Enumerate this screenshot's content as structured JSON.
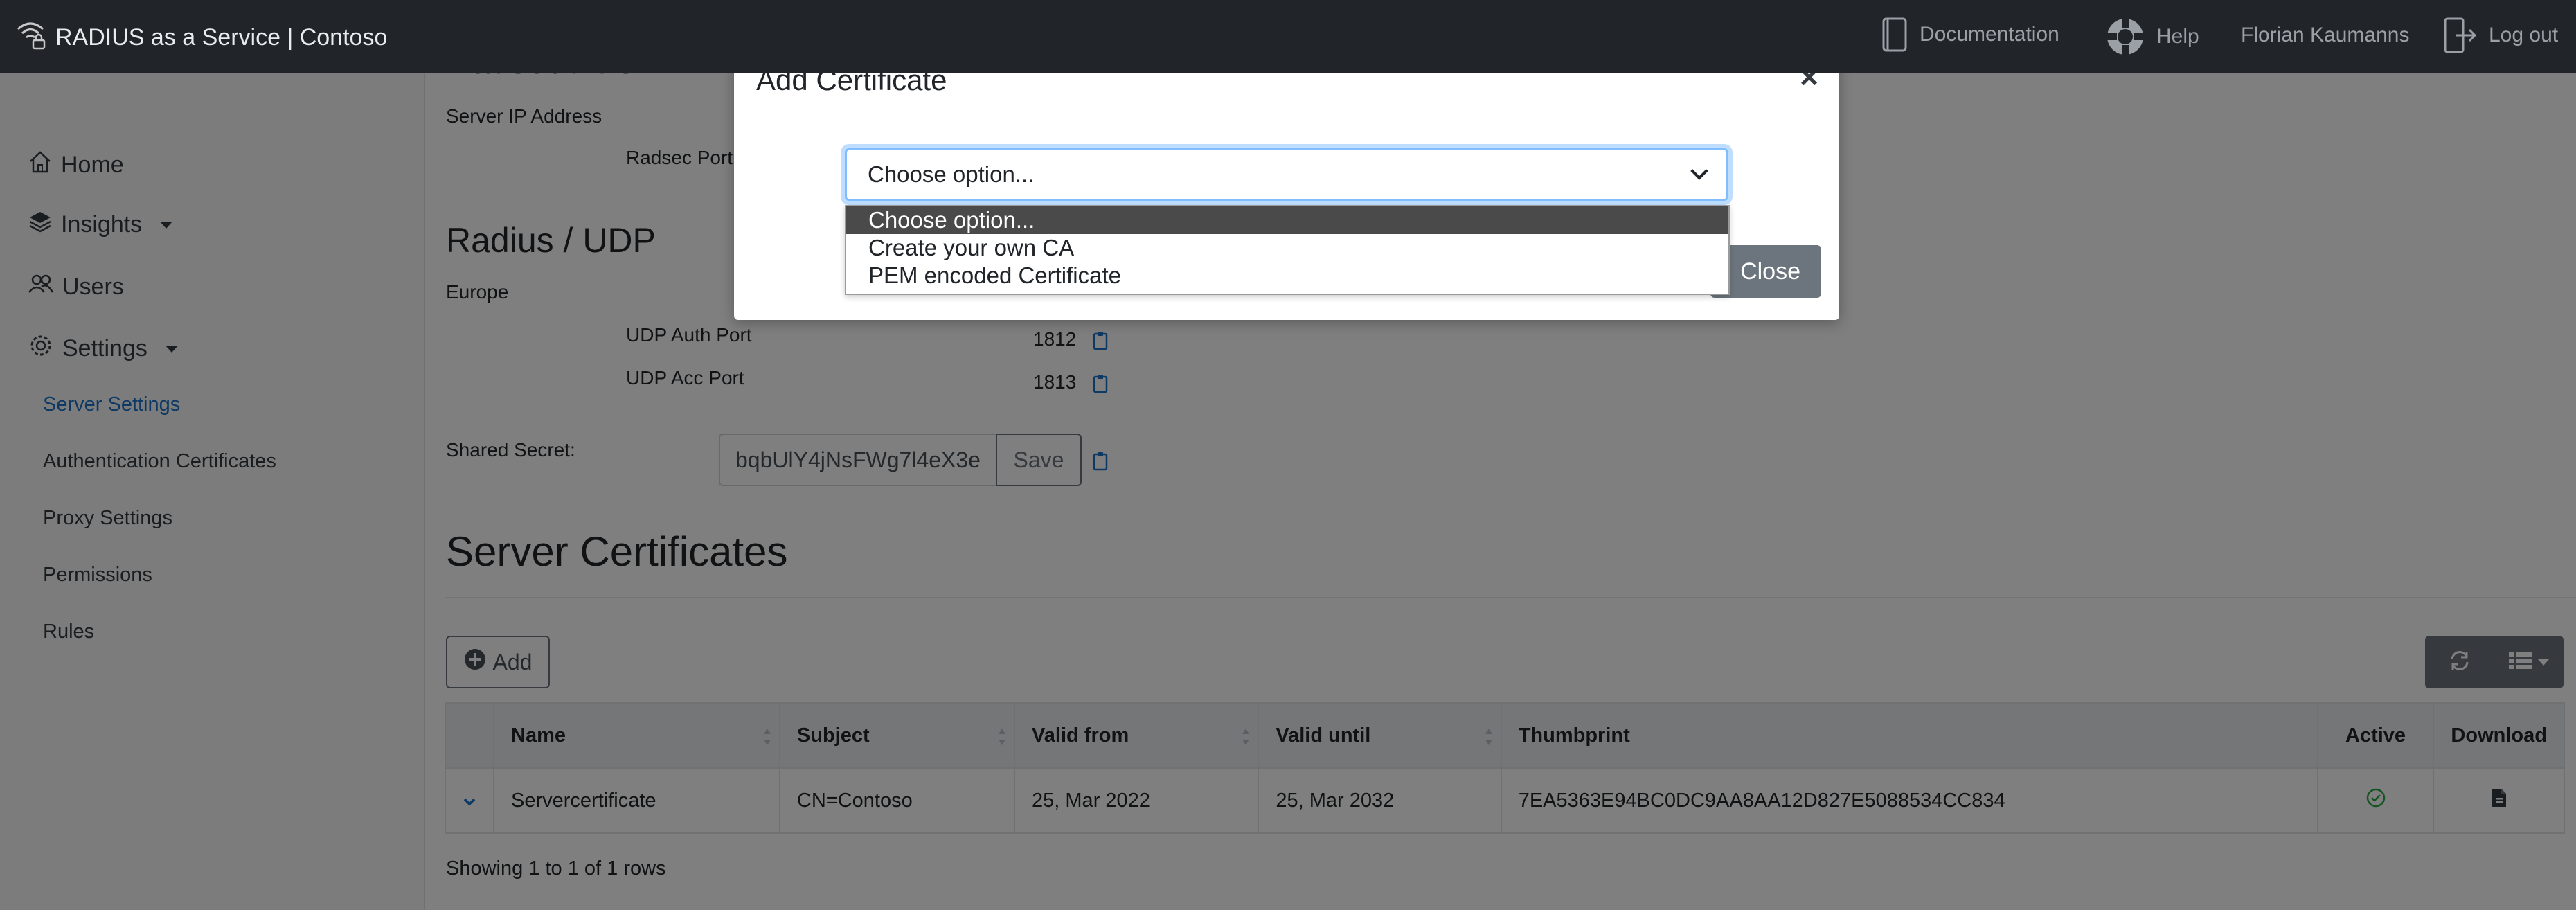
{
  "app": {
    "title": "RADIUS as a Service | Contoso",
    "nav": {
      "documentation": "Documentation",
      "help": "Help",
      "user": "Florian Kaumanns",
      "logout": "Log out"
    }
  },
  "sidebar": {
    "items": [
      {
        "label": "Home"
      },
      {
        "label": "Insights"
      },
      {
        "label": "Users"
      },
      {
        "label": "Settings"
      }
    ],
    "settings_sub": [
      {
        "label": "Server Settings"
      },
      {
        "label": "Authentication Certificates"
      },
      {
        "label": "Proxy Settings"
      },
      {
        "label": "Permissions"
      },
      {
        "label": "Rules"
      }
    ]
  },
  "main": {
    "radsec_title": "Radsec / TCP",
    "server_ip_label": "Server IP Address",
    "radsec_port_label": "Radsec Port",
    "udp_title": "Radius / UDP",
    "region": "Europe",
    "udp_auth_label": "UDP Auth Port",
    "udp_auth_value": "1812",
    "udp_acc_label": "UDP Acc Port",
    "udp_acc_value": "1813",
    "shared_secret_label": "Shared Secret:",
    "shared_secret_value": "bqbUlY4jNsFWg7l4eX3e",
    "save_label": "Save",
    "server_certs_title": "Server Certificates",
    "add_label": "Add",
    "table": {
      "headers": [
        "Name",
        "Subject",
        "Valid from",
        "Valid until",
        "Thumbprint",
        "Active",
        "Download"
      ],
      "rows": [
        {
          "name": "Servercertificate",
          "subject": "CN=Contoso",
          "valid_from": "25, Mar 2022",
          "valid_until": "25, Mar 2032",
          "thumbprint": "7EA5363E94BC0DC9AA8AA12D827E5088534CC834"
        }
      ]
    },
    "showing": "Showing 1 to 1 of 1 rows"
  },
  "modal": {
    "title": "Add Certificate",
    "close_symbol": "×",
    "select_value": "Choose option...",
    "options": [
      "Choose option...",
      "Create your own CA",
      "PEM encoded Certificate"
    ],
    "close_label": "Close"
  }
}
